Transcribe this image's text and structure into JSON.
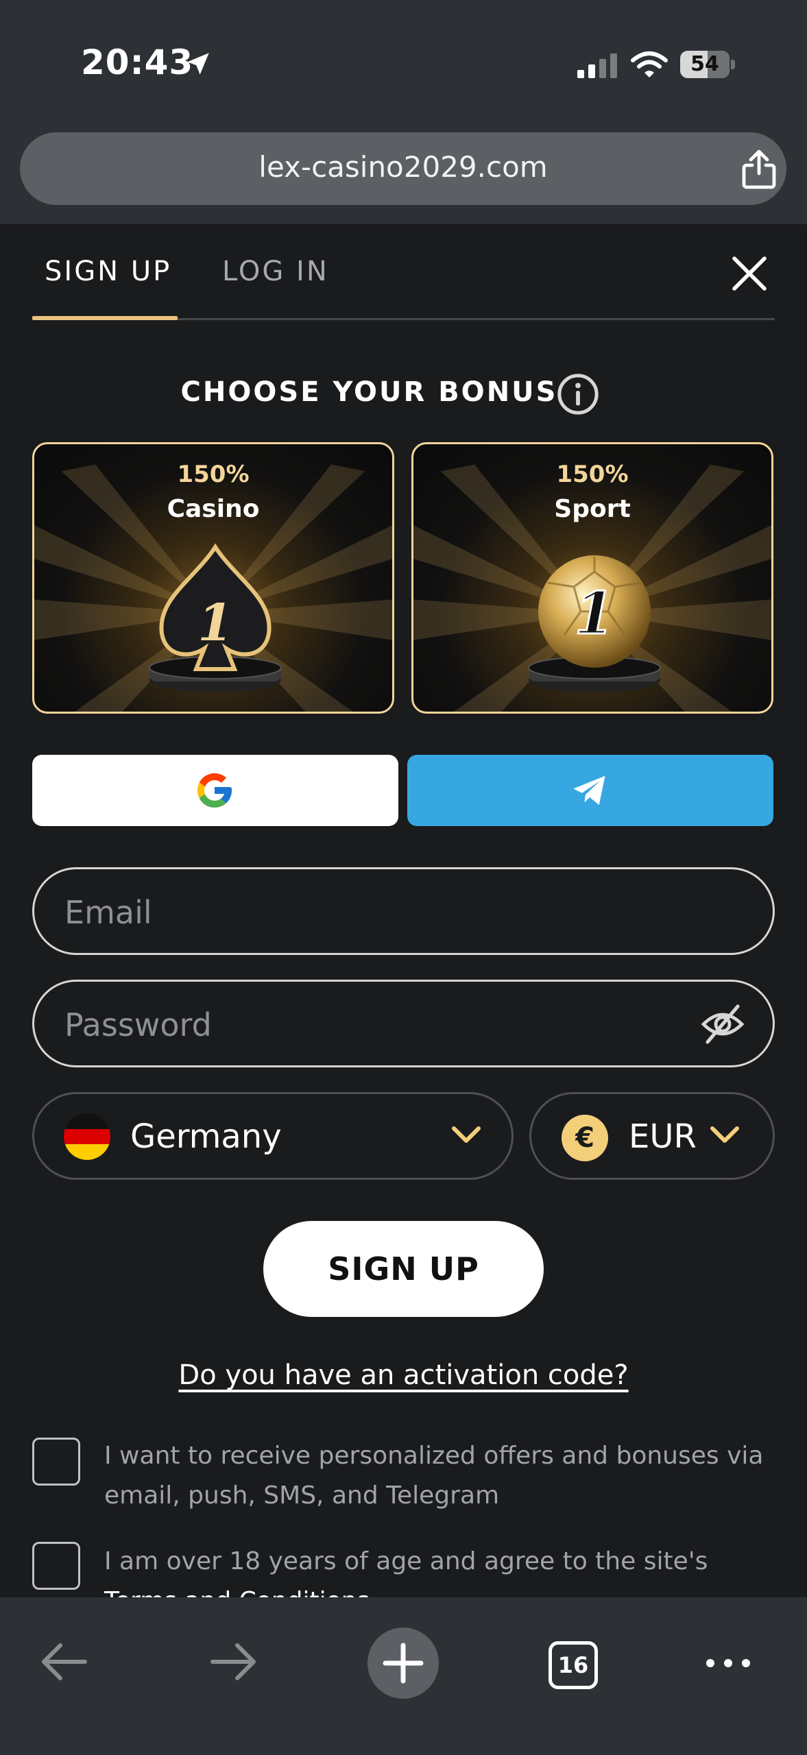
{
  "status_bar": {
    "time": "20:43",
    "battery": "54"
  },
  "browser": {
    "url": "lex-casino2029.com",
    "tab_count": "16"
  },
  "tabs": {
    "signup": "SIGN UP",
    "login": "LOG IN"
  },
  "bonus": {
    "title": "CHOOSE YOUR BONUS",
    "cards": [
      {
        "percent": "150%",
        "name": "Casino",
        "badge": "1"
      },
      {
        "percent": "150%",
        "name": "Sport",
        "badge": "1"
      }
    ]
  },
  "form": {
    "email_placeholder": "Email",
    "password_placeholder": "Password",
    "country": "Germany",
    "currency": "EUR",
    "currency_symbol": "€",
    "submit_label": "SIGN UP",
    "activation_link": "Do you have an activation code?"
  },
  "consents": {
    "offers": "I want to receive personalized offers and bonuses via email, push, SMS, and Telegram",
    "age_prefix": "I am over 18 years of age and agree to the site's ",
    "terms_link": "Terms and Conditions"
  },
  "colors": {
    "accent_gold": "#e9c27e",
    "telegram_blue": "#36a7e1",
    "background": "#1a1b1d"
  }
}
